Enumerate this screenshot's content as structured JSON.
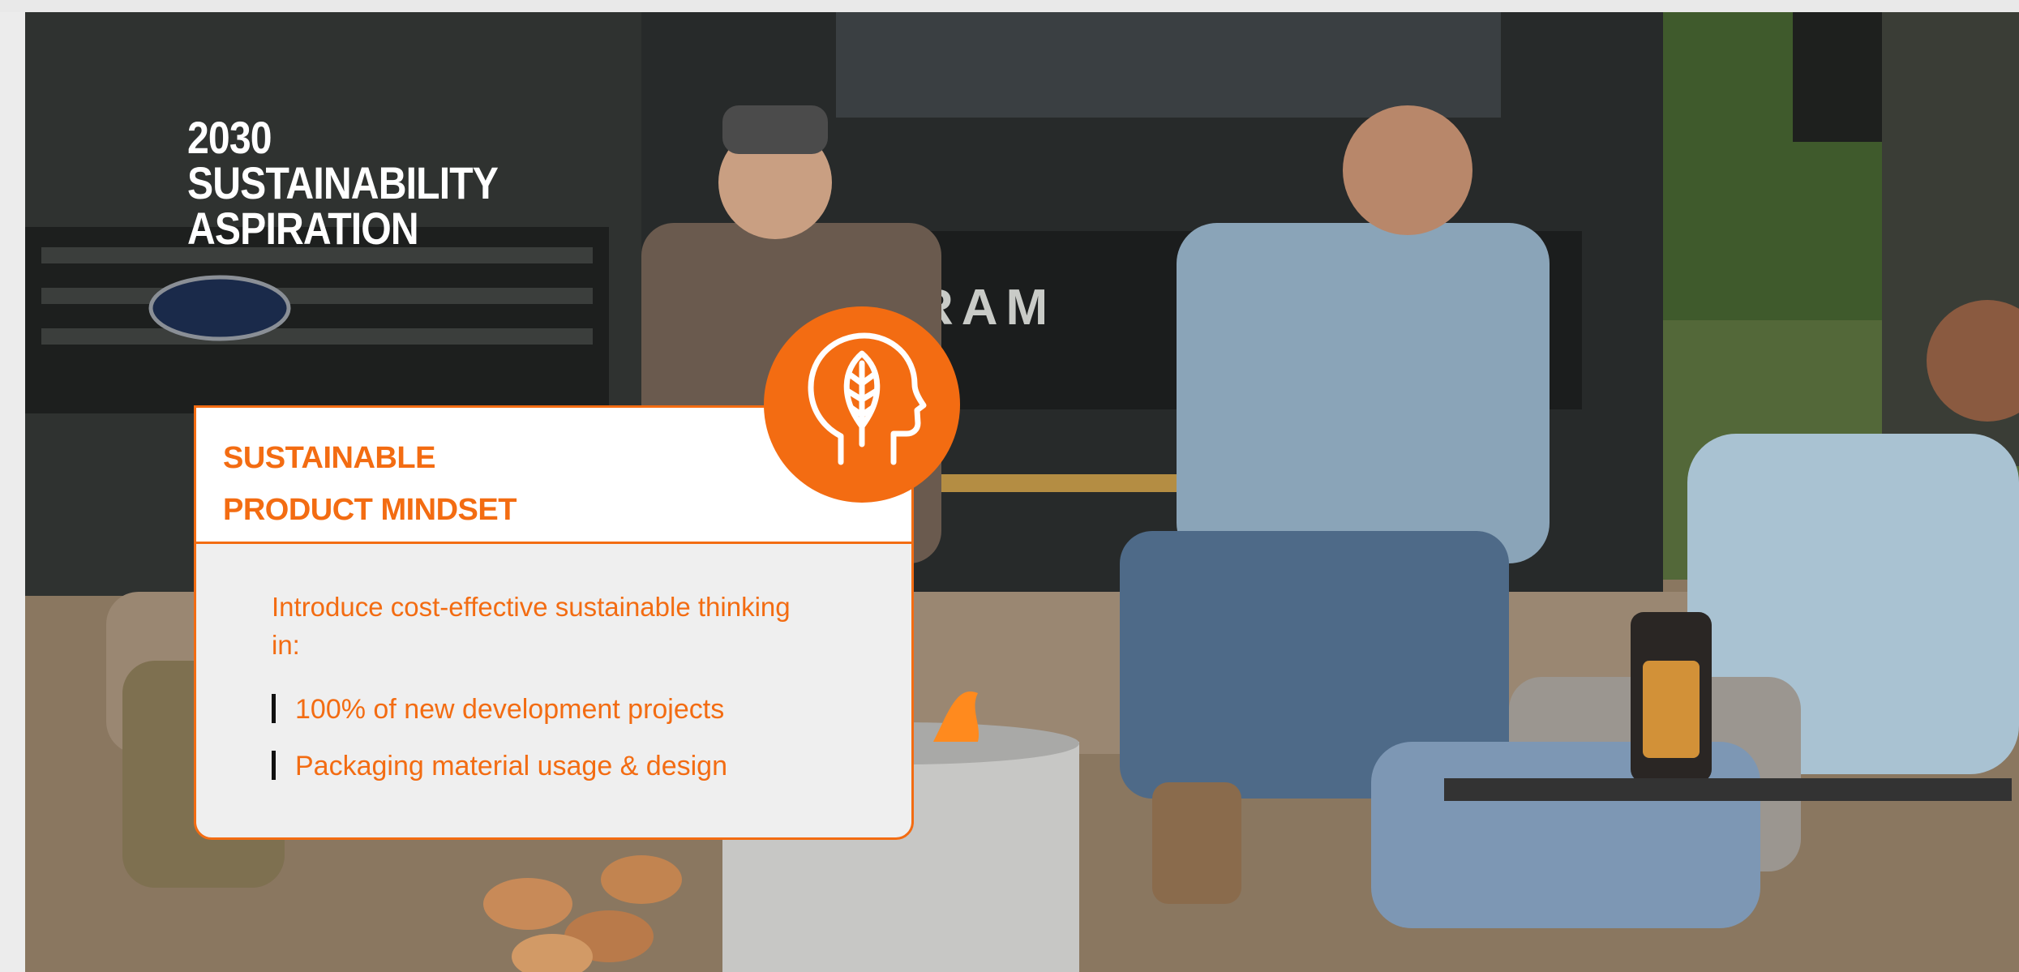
{
  "slide": {
    "title": "2030 SUSTAINABILITY ASPIRATION"
  },
  "photo": {
    "truck_badge": "RAM"
  },
  "card": {
    "heading_line1": "SUSTAINABLE",
    "heading_line2": "PRODUCT MINDSET",
    "icon": "head-leaf-icon",
    "intro": "Introduce cost-effective sustainable thinking in:",
    "bullets": [
      "100% of new development projects",
      "Packaging material usage & design"
    ]
  },
  "colors": {
    "accent": "#f36c12",
    "card_background": "#efefef",
    "title_text": "#ffffff"
  }
}
